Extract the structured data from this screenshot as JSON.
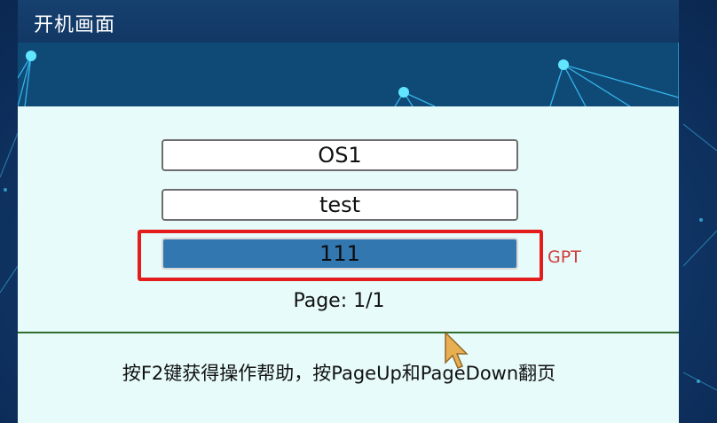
{
  "window": {
    "title": "开机画面"
  },
  "boot_menu": {
    "items": [
      {
        "label": "OS1",
        "selected": false
      },
      {
        "label": "test",
        "selected": false
      },
      {
        "label": "111",
        "selected": true
      }
    ],
    "selected_tag": "GPT",
    "page_indicator": "Page: 1/1"
  },
  "footer": {
    "help_text": "按F2键获得操作帮助，按PageUp和PageDown翻页"
  },
  "colors": {
    "background": "#123a6d",
    "panel": "#e6fbfa",
    "selected_item": "#3277b0",
    "highlight_border": "#e41c1c",
    "tag_text": "#d23a3a",
    "divider": "#2f6d2f"
  }
}
